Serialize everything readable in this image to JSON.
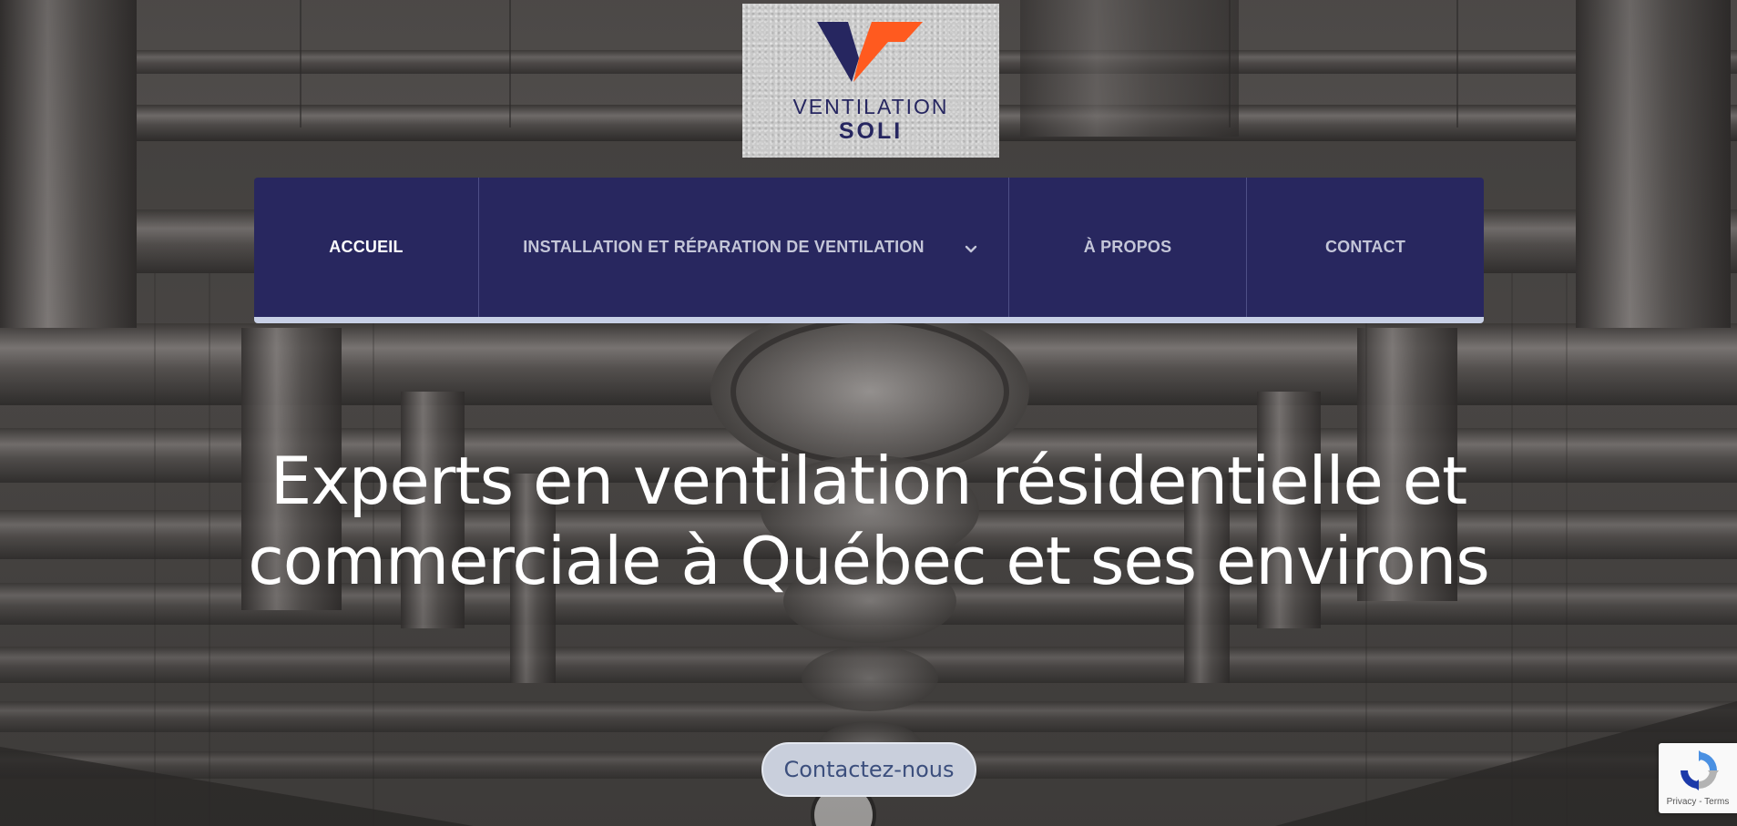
{
  "logo": {
    "word1": "VENTILATION",
    "word2": "SOLI",
    "colors": {
      "navy": "#262660",
      "orange": "#ff5a1f"
    }
  },
  "nav": {
    "items": [
      {
        "label": "ACCUEIL",
        "active": true
      },
      {
        "label": "INSTALLATION ET RÉPARATION DE VENTILATION",
        "has_dropdown": true,
        "icon": "chevron-down-icon"
      },
      {
        "label": "À PROPOS"
      },
      {
        "label": "CONTACT"
      }
    ],
    "colors": {
      "background": "#28275f",
      "underline": "#c8d0e6"
    }
  },
  "hero": {
    "title": "Experts en ventilation résidentielle et commerciale à Québec et ses environs",
    "cta_label": "Contactez-nous"
  },
  "recaptcha": {
    "privacy": "Privacy",
    "separator": "-",
    "terms": "Terms",
    "icon": "recaptcha-icon"
  }
}
